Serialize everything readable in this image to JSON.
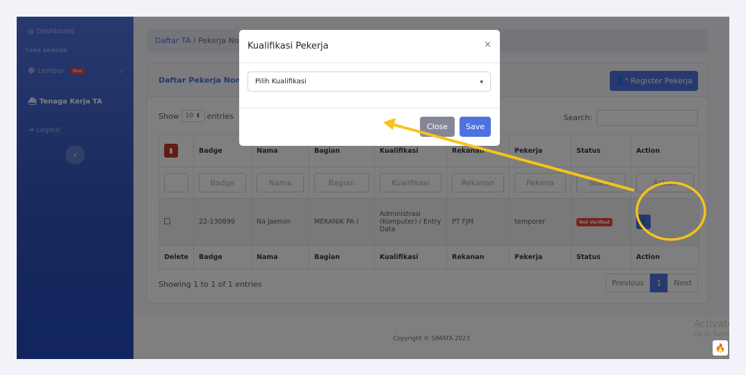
{
  "sidebar": {
    "dashboard": "Dashboard",
    "section_heading": "TURN AROUND",
    "lembur": "Lembur",
    "lembur_badge": "New",
    "tenaga_kerja": "Tenaga Kerja TA",
    "logout": "Logout"
  },
  "breadcrumb": {
    "root": "Daftar TA",
    "separator": "/",
    "current": "Pekerja Non-C"
  },
  "card": {
    "title": "Daftar Pekerja Non-C",
    "register_button": "Register Pekerja"
  },
  "table_controls": {
    "show_label": "Show",
    "entries_value": "10",
    "entries_label": "entries",
    "search_label": "Search:"
  },
  "table": {
    "headers": [
      "Badge",
      "Nama",
      "Bagian",
      "Kualifikasi",
      "Rekanan",
      "Pekerja",
      "Status",
      "Action"
    ],
    "filters": [
      "Badge",
      "Nama",
      "Bagian",
      "Kualifikasi",
      "Rekanan",
      "Pekerja",
      "Status",
      "Action"
    ],
    "rows": [
      {
        "badge": "22-130899",
        "nama": "Na Jaemin",
        "bagian": "MEKANIK PA I",
        "kualifikasi": "Administrasi (Komputer) / Entry Data",
        "rekanan": "PT FJM",
        "pekerja": "temporer",
        "status": "Not Verified"
      }
    ],
    "footer": [
      "Delete",
      "Badge",
      "Nama",
      "Bagian",
      "Kualifikasi",
      "Rekanan",
      "Pekerja",
      "Status",
      "Action"
    ]
  },
  "pagination": {
    "info": "Showing 1 to 1 of 1 entries",
    "previous": "Previous",
    "page": "1",
    "next": "Next"
  },
  "footer": {
    "copyright": "Copyright © SIMATA 2023"
  },
  "watermark": {
    "title": "Activate Windows",
    "subtitle": "Go to Settings to activate Windows."
  },
  "modal": {
    "title": "Kualifikasi Pekerja",
    "close_symbol": "×",
    "select_value": "Pilih Kualifikasi",
    "close_button": "Close",
    "save_button": "Save"
  },
  "colors": {
    "primary": "#4e73df",
    "danger": "#e74a3b",
    "annotation": "#f6c31a"
  },
  "icons": [
    "dashboard-icon",
    "users-icon",
    "ship-icon",
    "logout-icon",
    "trash-icon",
    "user-plus-icon",
    "user-cog-icon",
    "flame-icon"
  ]
}
